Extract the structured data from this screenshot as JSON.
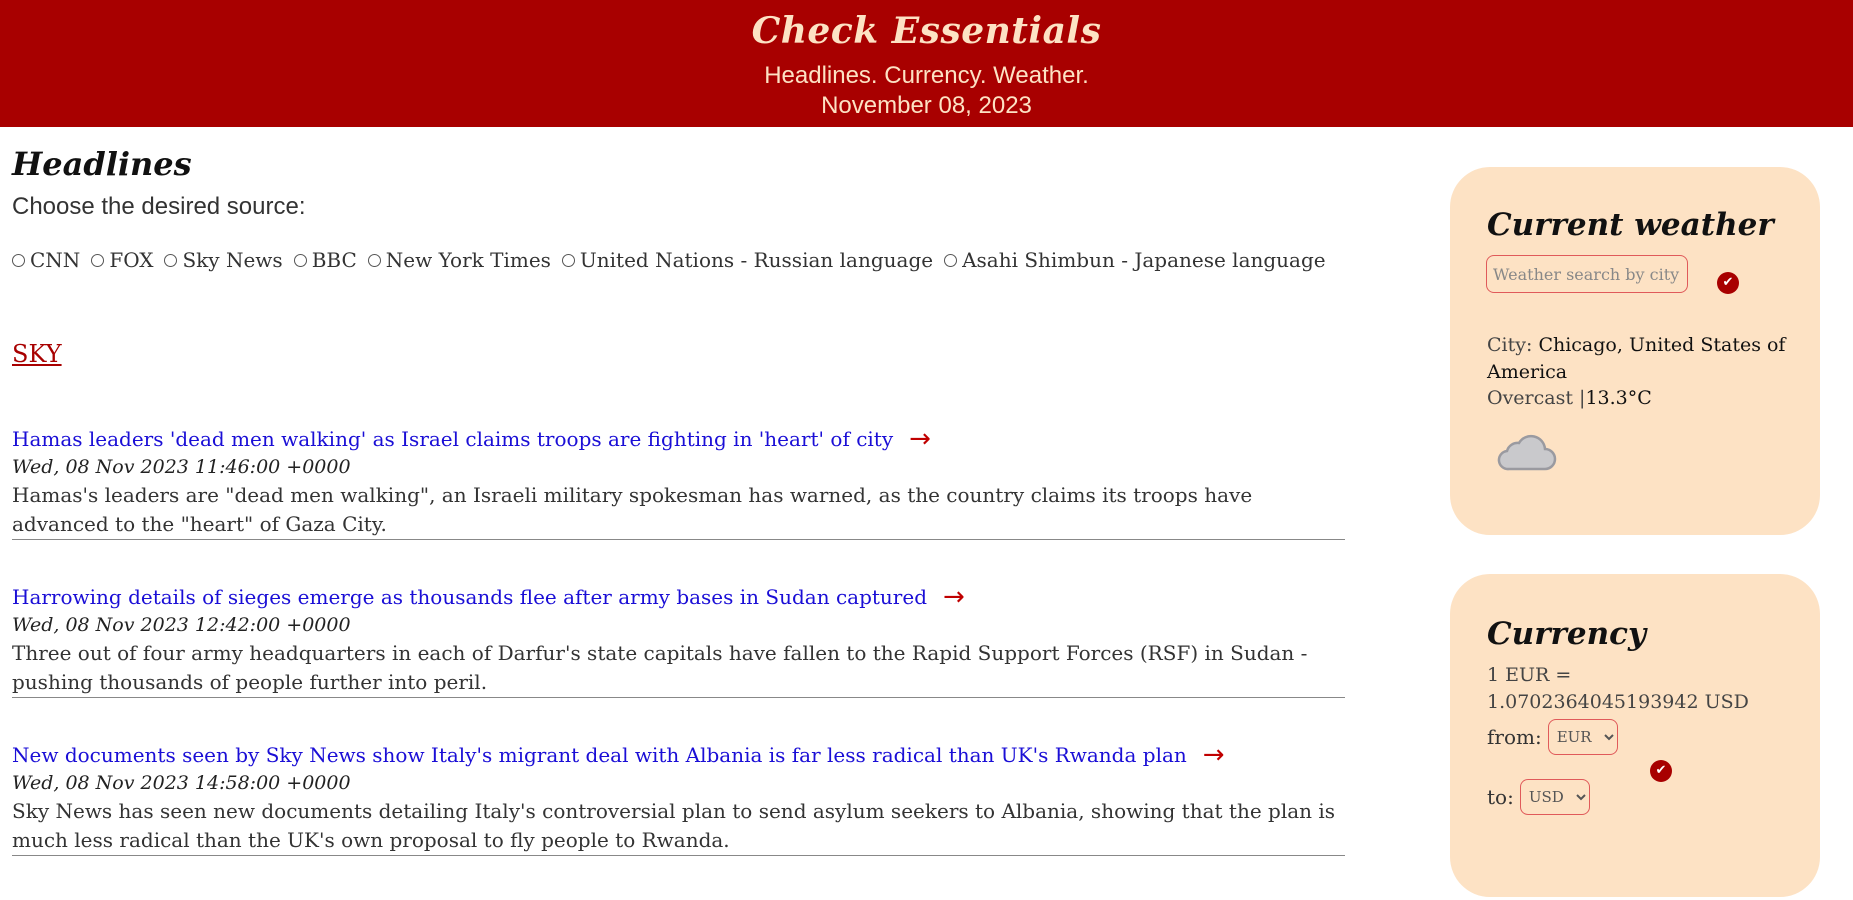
{
  "header": {
    "brand": "Check Essentials",
    "tagline": "Headlines. Currency. Weather.",
    "date": "November 08, 2023"
  },
  "headlines": {
    "title": "Headlines",
    "prompt": "Choose the desired source:",
    "sources": [
      "CNN",
      "FOX",
      "Sky News",
      "BBC",
      "New York Times",
      "United Nations - Russian language",
      "Asahi Shimbun - Japanese language"
    ],
    "selected_source_tag": "SKY",
    "articles": [
      {
        "title": "Hamas leaders 'dead men walking' as Israel claims troops are fighting in 'heart' of city",
        "date": "Wed, 08 Nov 2023 11:46:00 +0000",
        "description": "Hamas's leaders are \"dead men walking\", an Israeli military spokesman has warned, as the country claims its troops have advanced to the \"heart\" of Gaza City."
      },
      {
        "title": "Harrowing details of sieges emerge as thousands flee after army bases in Sudan captured",
        "date": "Wed, 08 Nov 2023 12:42:00 +0000",
        "description": "Three out of four army headquarters in each of Darfur's state capitals have fallen to the Rapid Support Forces (RSF) in Sudan - pushing thousands of people further into peril."
      },
      {
        "title": "New documents seen by Sky News show Italy's migrant deal with Albania is far less radical than UK's Rwanda plan",
        "date": "Wed, 08 Nov 2023 14:58:00 +0000",
        "description": "Sky News has seen new documents detailing Italy's controversial plan to send asylum seekers to Albania, showing that the plan is much less radical than the UK's own proposal to fly people to Rwanda."
      }
    ],
    "arrow_glyph": "→"
  },
  "weather": {
    "title": "Current weather",
    "search_placeholder": "Weather search by city",
    "city_label": "City:",
    "city_value": "Chicago, United States of America",
    "condition": "Overcast",
    "separator": "|",
    "temperature": "13.3°C",
    "icon": "cloud-icon"
  },
  "currency": {
    "title": "Currency",
    "rate_text": "1 EUR = 1.0702364045193942 USD",
    "from_label": "from:",
    "from_value": "EUR",
    "to_label": "to:",
    "to_value": "USD"
  },
  "colors": {
    "brand_red": "#a80000",
    "cream": "#fde2c4",
    "link_blue": "#1a0ed6"
  }
}
